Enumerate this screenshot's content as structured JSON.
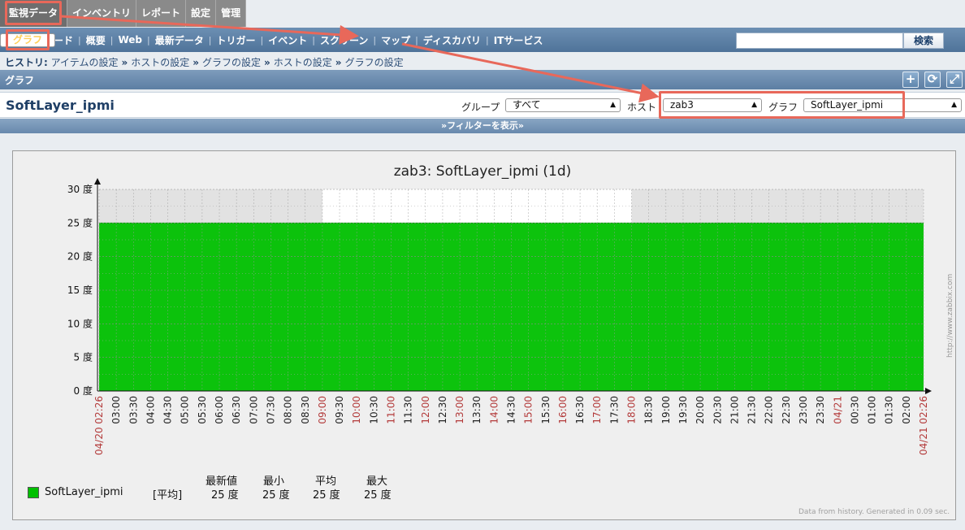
{
  "top_menu": [
    {
      "label": "監視データ",
      "active": true,
      "highlighted": true
    },
    {
      "label": "インベントリ"
    },
    {
      "label": "レポート"
    },
    {
      "label": "設定"
    },
    {
      "label": "管理"
    }
  ],
  "sub_menu": [
    {
      "label": "ダッシュボード"
    },
    {
      "label": "概要"
    },
    {
      "label": "Web"
    },
    {
      "label": "最新データ"
    },
    {
      "label": "トリガー"
    },
    {
      "label": "イベント"
    },
    {
      "label": "グラフ",
      "selected": true
    },
    {
      "label": "スクリーン"
    },
    {
      "label": "マップ"
    },
    {
      "label": "ディスカバリ"
    },
    {
      "label": "ITサービス"
    }
  ],
  "search": {
    "value": "",
    "button": "検索"
  },
  "breadcrumb": {
    "label": "ヒストリ:",
    "items": [
      "アイテムの設定",
      "ホストの設定",
      "グラフの設定",
      "ホストの設定",
      "グラフの設定"
    ],
    "separator": "»"
  },
  "header": {
    "title": "グラフ",
    "icons": [
      "add-icon",
      "refresh-icon",
      "fullscreen-icon"
    ]
  },
  "graph_row": {
    "name": "SoftLayer_ipmi",
    "group_label": "グループ",
    "group_value": "すべて",
    "host_label": "ホスト",
    "host_value": "zab3",
    "graph_label": "グラフ",
    "graph_value": "SoftLayer_ipmi"
  },
  "filter": {
    "label": "フィルターを表示"
  },
  "graph": {
    "title": "zab3: SoftLayer_ipmi (1d)",
    "footnote": "Data from history. Generated in 0.09 sec.",
    "brand": "http://www.zabbix.com",
    "legend": {
      "name": "SoftLayer_ipmi",
      "func": "[平均]",
      "headers": [
        "最新値",
        "最小",
        "平均",
        "最大"
      ],
      "values": [
        "25 度",
        "25 度",
        "25 度",
        "25 度"
      ],
      "color": "#00c000"
    }
  },
  "chart_data": {
    "type": "area",
    "title": "zab3: SoftLayer_ipmi (1d)",
    "ylim": [
      0,
      30
    ],
    "yticks": [
      "0 度",
      "5 度",
      "10 度",
      "15 度",
      "20 度",
      "25 度",
      "30 度"
    ],
    "xticks": [
      "04/20 02:26",
      "03:00",
      "03:30",
      "04:00",
      "04:30",
      "05:00",
      "05:30",
      "06:00",
      "06:30",
      "07:00",
      "07:30",
      "08:00",
      "08:30",
      "09:00",
      "09:30",
      "10:00",
      "10:30",
      "11:00",
      "11:30",
      "12:00",
      "12:30",
      "13:00",
      "13:30",
      "14:00",
      "14:30",
      "15:00",
      "15:30",
      "16:00",
      "16:30",
      "17:00",
      "17:30",
      "18:00",
      "18:30",
      "19:00",
      "19:30",
      "20:00",
      "20:30",
      "21:00",
      "21:30",
      "22:00",
      "22:30",
      "23:00",
      "23:30",
      "04/21",
      "00:30",
      "01:00",
      "01:30",
      "02:00",
      "04/21 02:26"
    ],
    "red_ticks": [
      "04/20 02:26",
      "09:00",
      "10:00",
      "11:00",
      "12:00",
      "13:00",
      "14:00",
      "15:00",
      "16:00",
      "17:00",
      "18:00",
      "04/21",
      "04/21 02:26"
    ],
    "series": [
      {
        "name": "SoftLayer_ipmi",
        "value": 25,
        "color": "#00c000"
      }
    ],
    "grid": true
  }
}
